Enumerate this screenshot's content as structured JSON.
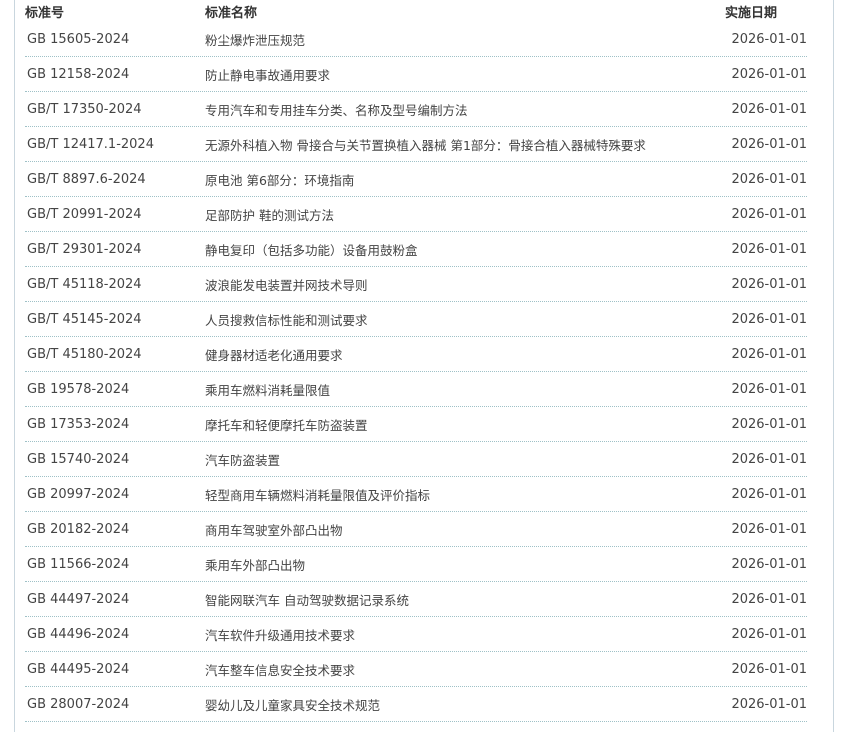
{
  "table": {
    "headers": {
      "code": "标准号",
      "name": "标准名称",
      "date": "实施日期"
    },
    "rows": [
      {
        "code": "GB 15605-2024",
        "name": "粉尘爆炸泄压规范",
        "date": "2026-01-01"
      },
      {
        "code": "GB 12158-2024",
        "name": "防止静电事故通用要求",
        "date": "2026-01-01"
      },
      {
        "code": "GB/T 17350-2024",
        "name": "专用汽车和专用挂车分类、名称及型号编制方法",
        "date": "2026-01-01"
      },
      {
        "code": "GB/T 12417.1-2024",
        "name": "无源外科植入物 骨接合与关节置换植入器械 第1部分：骨接合植入器械特殊要求",
        "date": "2026-01-01"
      },
      {
        "code": "GB/T 8897.6-2024",
        "name": "原电池 第6部分：环境指南",
        "date": "2026-01-01"
      },
      {
        "code": "GB/T 20991-2024",
        "name": "足部防护 鞋的测试方法",
        "date": "2026-01-01"
      },
      {
        "code": "GB/T 29301-2024",
        "name": "静电复印（包括多功能）设备用鼓粉盒",
        "date": "2026-01-01"
      },
      {
        "code": "GB/T 45118-2024",
        "name": "波浪能发电装置并网技术导则",
        "date": "2026-01-01"
      },
      {
        "code": "GB/T 45145-2024",
        "name": "人员搜救信标性能和测试要求",
        "date": "2026-01-01"
      },
      {
        "code": "GB/T 45180-2024",
        "name": "健身器材适老化通用要求",
        "date": "2026-01-01"
      },
      {
        "code": "GB 19578-2024",
        "name": "乘用车燃料消耗量限值",
        "date": "2026-01-01"
      },
      {
        "code": "GB 17353-2024",
        "name": "摩托车和轻便摩托车防盗装置",
        "date": "2026-01-01"
      },
      {
        "code": "GB 15740-2024",
        "name": "汽车防盗装置",
        "date": "2026-01-01"
      },
      {
        "code": "GB 20997-2024",
        "name": "轻型商用车辆燃料消耗量限值及评价指标",
        "date": "2026-01-01"
      },
      {
        "code": "GB 20182-2024",
        "name": "商用车驾驶室外部凸出物",
        "date": "2026-01-01"
      },
      {
        "code": "GB 11566-2024",
        "name": "乘用车外部凸出物",
        "date": "2026-01-01"
      },
      {
        "code": "GB 44497-2024",
        "name": "智能网联汽车 自动驾驶数据记录系统",
        "date": "2026-01-01"
      },
      {
        "code": "GB 44496-2024",
        "name": "汽车软件升级通用技术要求",
        "date": "2026-01-01"
      },
      {
        "code": "GB 44495-2024",
        "name": "汽车整车信息安全技术要求",
        "date": "2026-01-01"
      },
      {
        "code": "GB 28007-2024",
        "name": "婴幼儿及儿童家具安全技术规范",
        "date": "2026-01-01"
      }
    ]
  }
}
